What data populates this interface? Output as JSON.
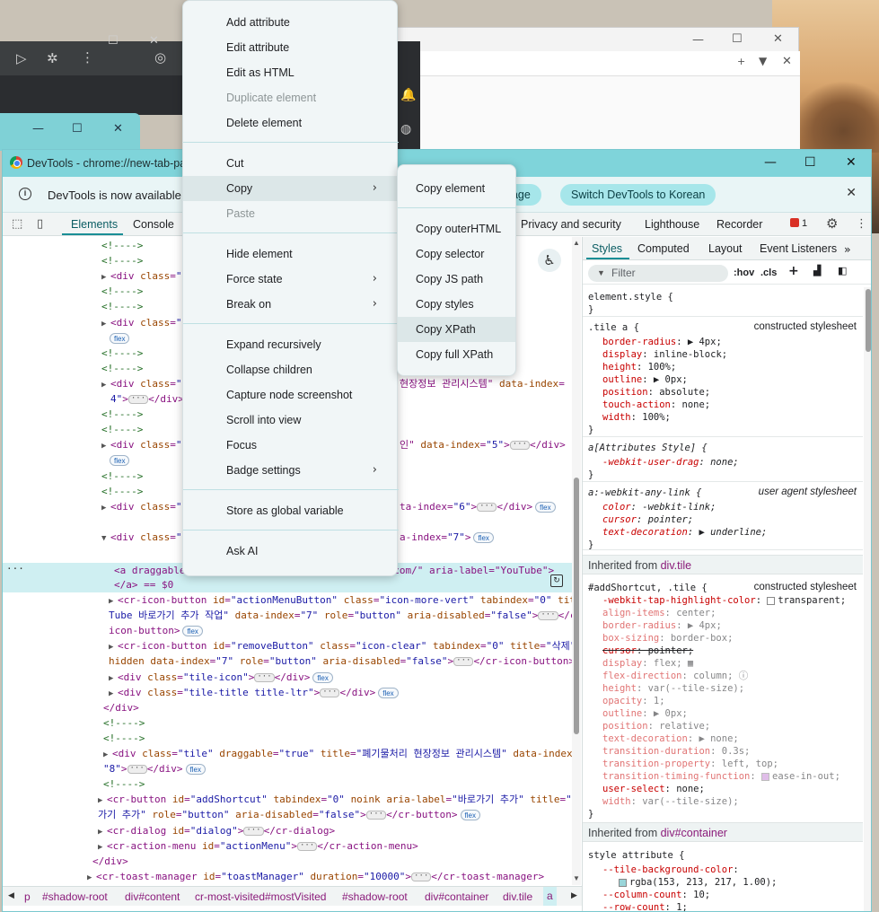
{
  "devtools_window": {
    "title": "DevTools - chrome://new-tab-pa",
    "info_message": "DevTools is now available",
    "language_button": "uage",
    "switch_button": "Switch DevTools to Korean",
    "tabs": [
      "Elements",
      "Console",
      "Privacy and security",
      "Lighthouse",
      "Recorder"
    ],
    "issues_count": "1"
  },
  "elements": {
    "lines": [
      {
        "indent": 0,
        "html": "<span class='cm'>&lt;!----&gt;</span>"
      },
      {
        "indent": 0,
        "html": "<span class='cm'>&lt;!----&gt;</span>"
      },
      {
        "indent": 0,
        "html": "<span class='tri'>▶</span>&lt;div <span class='at'>class</span>=<span class='av'>\"ti</span>"
      },
      {
        "indent": 0,
        "html": "<span class='cm'>&lt;!----&gt;</span>"
      },
      {
        "indent": 0,
        "html": "<span class='cm'>&lt;!----&gt;</span>"
      },
      {
        "indent": 0,
        "html": "<span class='tri'>▶</span>&lt;div <span class='at'>class</span>=<span class='av'>\"til</span>"
      },
      {
        "indent": 1,
        "html": ""
      },
      {
        "indent": 0,
        "html": "<span class='cm'>&lt;!----&gt;</span>"
      },
      {
        "indent": 0,
        "html": "<span class='cm'>&lt;!----&gt;</span>"
      },
      {
        "indent": 0,
        "html": "<span class='tri'>▶</span>&lt;div <span class='at'>class</span>=<span class='av'>\"til</span>"
      },
      {
        "indent": 1,
        "html": "<span class='av'>4\"</span>&gt;<span class='dots'>···</span>&lt;/div&gt;"
      },
      {
        "indent": 0,
        "html": "<span class='cm'>&lt;!----&gt;</span>"
      },
      {
        "indent": 0,
        "html": "<span class='cm'>&lt;!----&gt;</span>"
      },
      {
        "indent": 0,
        "html": "<span class='tri'>▶</span>&lt;div <span class='at'>class</span>=<span class='av'>\"ti</span>"
      },
      {
        "indent": 1,
        "html": ""
      },
      {
        "indent": 0,
        "html": "<span class='cm'>&lt;!----&gt;</span>"
      },
      {
        "indent": 0,
        "html": "<span class='cm'>&lt;!----&gt;</span>"
      },
      {
        "indent": 0,
        "html": "<span class='tri'>▶</span>&lt;div <span class='at'>class</span>=<span class='av'>\"ti</span>"
      },
      {
        "indent": 0,
        "html": ""
      },
      {
        "indent": 0,
        "html": "<span class='tri'>▼</span>&lt;div <span class='at'>class</span>=<span class='av'>\"ti</span>"
      }
    ],
    "right_fragments": [
      {
        "row": 2,
        "html": "v&gt;<span class='fx'>flex</span>"
      },
      {
        "row": 5,
        "html": "&lt;/div&gt;"
      },
      {
        "row": 9,
        "html": "현장정보 관리시스템\" <span class='at'>data-index</span>="
      },
      {
        "row": 13,
        "html": "인\" <span class='at'>data-index</span>=<span class='av'>\"5\"</span>&gt;<span class='dots'>···</span>&lt;/div&gt;"
      },
      {
        "row": 17,
        "html": "ta-index=<span class='av'>\"6\"</span>&gt;<span class='dots'>···</span>&lt;/div&gt;<span class='fx'>flex</span>"
      },
      {
        "row": 19,
        "html": "a-index=<span class='av'>\"7\"</span>&gt;<span class='fx'>flex</span>"
      }
    ],
    "selected_line_1": "<a draggable=\"false\" href=\"https://www.youtube.com/\" aria-label=\"YouTube\">",
    "selected_line_2": "</a> == $0",
    "after_lines": [
      {
        "indent": 1,
        "html": "<span class='tri'>▶</span>&lt;cr-icon-button <span class='at'>id</span>=<span class='av'>\"actionMenuButton\"</span> <span class='at'>class</span>=<span class='av'>\"icon-more-vert\"</span> <span class='at'>tabindex</span>=<span class='av'>\"0\"</span> <span class='at'>title</span>=<span class='av'>\"You</span>"
      },
      {
        "indent": 1,
        "html": "<span class='av'>Tube 바로가기 추가 작업\"</span> <span class='at'>data-index</span>=<span class='av'>\"7\"</span> <span class='at'>role</span>=<span class='av'>\"button\"</span> <span class='at'>aria-disabled</span>=<span class='av'>\"false\"</span>&gt;<span class='dots'>···</span>&lt;/cr-"
      },
      {
        "indent": 1,
        "html": "icon-button&gt;<span class='fx'>flex</span>"
      },
      {
        "indent": 1,
        "html": "<span class='tri'>▶</span>&lt;cr-icon-button <span class='at'>id</span>=<span class='av'>\"removeButton\"</span> <span class='at'>class</span>=<span class='av'>\"icon-clear\"</span> <span class='at'>tabindex</span>=<span class='av'>\"0\"</span> <span class='at'>title</span>=<span class='av'>\"삭제\"</span>"
      },
      {
        "indent": 1,
        "html": "<span class='at'>hidden</span> <span class='at'>data-index</span>=<span class='av'>\"7\"</span> <span class='at'>role</span>=<span class='av'>\"button\"</span> <span class='at'>aria-disabled</span>=<span class='av'>\"false\"</span>&gt;<span class='dots'>···</span>&lt;/cr-icon-button&gt;"
      },
      {
        "indent": 1,
        "html": "<span class='tri'>▶</span>&lt;div <span class='at'>class</span>=<span class='av'>\"tile-icon\"</span>&gt;<span class='dots'>···</span>&lt;/div&gt;<span class='fx'>flex</span>"
      },
      {
        "indent": 1,
        "html": "<span class='tri'>▶</span>&lt;div <span class='at'>class</span>=<span class='av'>\"tile-title title-ltr\"</span>&gt;<span class='dots'>···</span>&lt;/div&gt;<span class='fx'>flex</span>"
      },
      {
        "indent": 0,
        "html": "&lt;/div&gt;"
      },
      {
        "indent": 0,
        "html": "<span class='cm'>&lt;!----&gt;</span>"
      },
      {
        "indent": 0,
        "html": "<span class='cm'>&lt;!----&gt;</span>"
      },
      {
        "indent": 0,
        "html": "<span class='tri'>▶</span>&lt;div <span class='at'>class</span>=<span class='av'>\"tile\"</span> <span class='at'>draggable</span>=<span class='av'>\"true\"</span> <span class='at'>title</span>=<span class='av'>\"폐기물처리 현장정보 관리시스템\"</span> <span class='at'>data-index</span>="
      },
      {
        "indent": 0,
        "html": "<span class='av'>\"8\"</span>&gt;<span class='dots'>···</span>&lt;/div&gt;<span class='fx'>flex</span>"
      },
      {
        "indent": 0,
        "html": "<span class='cm'>&lt;!----&gt;</span>"
      },
      {
        "indent": -1,
        "html": "<span class='tri'>▶</span>&lt;cr-button <span class='at'>id</span>=<span class='av'>\"addShortcut\"</span> <span class='at'>tabindex</span>=<span class='av'>\"0\"</span> <span class='at'>noink</span> <span class='at'>aria-label</span>=<span class='av'>\"바로가기 추가\"</span> <span class='at'>title</span>=<span class='av'>\"바로</span>"
      },
      {
        "indent": -1,
        "html": "<span class='av'>가기 추가\"</span> <span class='at'>role</span>=<span class='av'>\"button\"</span> <span class='at'>aria-disabled</span>=<span class='av'>\"false\"</span>&gt;<span class='dots'>···</span>&lt;/cr-button&gt;<span class='fx'>flex</span>"
      },
      {
        "indent": -1,
        "html": "<span class='tri'>▶</span>&lt;cr-dialog <span class='at'>id</span>=<span class='av'>\"dialog\"</span>&gt;<span class='dots'>···</span>&lt;/cr-dialog&gt;"
      },
      {
        "indent": -1,
        "html": "<span class='tri'>▶</span>&lt;cr-action-menu <span class='at'>id</span>=<span class='av'>\"actionMenu\"</span>&gt;<span class='dots'>···</span>&lt;/cr-action-menu&gt;"
      },
      {
        "indent": -2,
        "html": "&lt;/div&gt;"
      },
      {
        "indent": -3,
        "html": "<span class='tri'>▶</span>&lt;cr-toast-manager <span class='at'>id</span>=<span class='av'>\"toastManager\"</span> <span class='at'>duration</span>=<span class='av'>\"10000\"</span>&gt;<span class='dots'>···</span>&lt;/cr-toast-manager&gt;"
      }
    ]
  },
  "breadcrumbs": [
    "p",
    "#shadow-root",
    "div#content",
    "cr-most-visited#mostVisited",
    "#shadow-root",
    "div#container",
    "div.tile",
    "a"
  ],
  "styles": {
    "tabs": [
      "Styles",
      "Computed",
      "Layout",
      "Event Listeners"
    ],
    "filter_placeholder": "Filter",
    "hov": ":hov",
    "cls": ".cls",
    "element_style": "element.style {",
    "inherited_1": "Inherited from",
    "inherited_1_sel": "div.tile",
    "inherited_2": "Inherited from",
    "inherited_2_sel": "div#container",
    "constructed": "constructed stylesheet",
    "user_agent": "user agent stylesheet"
  },
  "context_menu": {
    "groups": [
      [
        "Add attribute",
        "Edit attribute",
        "Edit as HTML",
        "Duplicate element",
        "Delete element"
      ],
      [
        "Cut",
        "Copy",
        "Paste"
      ],
      [
        "Hide element",
        "Force state",
        "Break on"
      ],
      [
        "Expand recursively",
        "Collapse children",
        "Capture node screenshot",
        "Scroll into view",
        "Focus",
        "Badge settings"
      ],
      [
        "Store as global variable"
      ],
      [
        "Ask AI"
      ]
    ]
  },
  "copy_submenu": {
    "items": [
      "Copy element",
      "Copy outerHTML",
      "Copy selector",
      "Copy JS path",
      "Copy styles",
      "Copy XPath",
      "Copy full XPath"
    ]
  }
}
